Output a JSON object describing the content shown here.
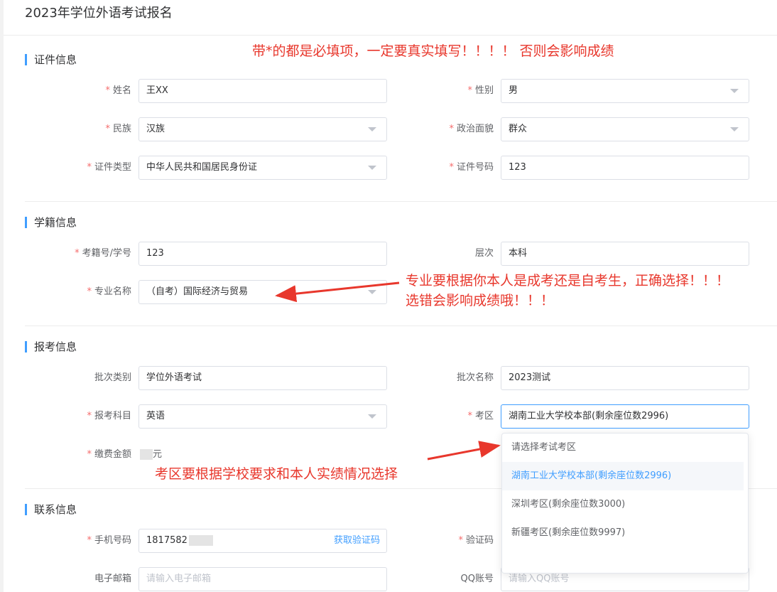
{
  "page_title": "2023年学位外语考试报名",
  "annotations": {
    "required_note": "带*的都是必填项，一定要真实填写！！！！ 否则会影响成绩",
    "major_note_line1": "专业要根据你本人是成考还是自考生，正确选择！！！",
    "major_note_line2": "选错会影响成绩哦！！！",
    "exam_area_note": "考区要根据学校要求和本人实绩情况选择"
  },
  "required_mark": "*",
  "sections": {
    "certificate": {
      "title": "证件信息",
      "name_label": "姓名",
      "name_value": "王XX",
      "gender_label": "性别",
      "gender_value": "男",
      "ethnicity_label": "民族",
      "ethnicity_value": "汉族",
      "political_label": "政治面貌",
      "political_value": "群众",
      "id_type_label": "证件类型",
      "id_type_value": "中华人民共和国居民身份证",
      "id_number_label": "证件号码",
      "id_number_value": "123"
    },
    "academic": {
      "title": "学籍信息",
      "student_no_label": "考籍号/学号",
      "student_no_value": "123",
      "level_label": "层次",
      "level_value": "本科",
      "major_label": "专业名称",
      "major_value": "（自考）国际经济与贸易"
    },
    "registration": {
      "title": "报考信息",
      "batch_type_label": "批次类别",
      "batch_type_value": "学位外语考试",
      "batch_name_label": "批次名称",
      "batch_name_value": "2023测试",
      "subject_label": "报考科目",
      "subject_value": "英语",
      "area_label": "考区",
      "area_value": "湖南工业大学校本部(剩余座位数2996)",
      "fee_label": "缴费金额",
      "fee_unit": "元"
    },
    "contact": {
      "title": "联系信息",
      "phone_label": "手机号码",
      "phone_value": "1817582",
      "get_code_label": "获取验证码",
      "code_label": "验证码",
      "email_label": "电子邮箱",
      "email_placeholder": "请输入电子邮箱",
      "qq_label": "QQ账号",
      "qq_placeholder": "请输入QQ账号"
    }
  },
  "area_dropdown": {
    "options": [
      "请选择考试考区",
      "湖南工业大学校本部(剩余座位数2996)",
      "深圳考区(剩余座位数3000)",
      "新疆考区(剩余座位数9997)"
    ],
    "selected": "湖南工业大学校本部(剩余座位数2996)"
  },
  "colors": {
    "accent": "#409eff",
    "required": "#f56c6c",
    "annotation": "#e8372c"
  }
}
